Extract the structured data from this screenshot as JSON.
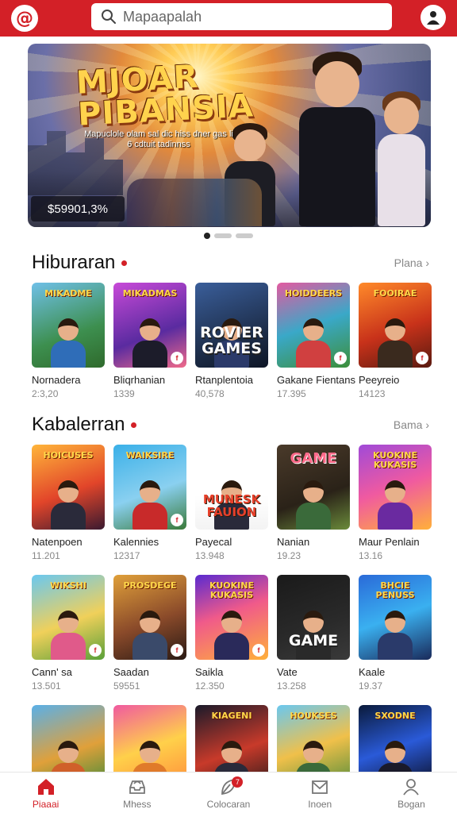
{
  "header": {
    "logo_glyph": "@",
    "search_placeholder": "Mapaapalah",
    "accent": "#d32027"
  },
  "banner": {
    "title_line1": "MJOAR",
    "title_line2": "PIBANSIA",
    "subtitle": "Mapuclole olam sal dic hiss dner gas li 6 cdtuit tadinnss",
    "price": "$59901,3%",
    "slide_count": 3,
    "active_slide": 1
  },
  "sections": [
    {
      "title": "Hiburaran",
      "see_all": "Plana",
      "items": [
        {
          "name": "Nornadera",
          "count": "2:3,20",
          "art": "MIKADME",
          "art_style": "top",
          "bg": "linear-gradient(160deg,#6fc0e8,#3d8f4f 60%,#2f6a2c)",
          "body": "#2f6db8",
          "badge": ""
        },
        {
          "name": "Bliqrhanian",
          "count": "1339",
          "art": "MIKADMAS",
          "art_style": "top",
          "bg": "linear-gradient(160deg,#c84ad8,#5a2ba0 60%,#f06a8a)",
          "body": "#1c1c2a",
          "badge": "f"
        },
        {
          "name": "Rtanplentoia",
          "count": "40,578",
          "art": "ROVIER GAMES",
          "art_style": "big",
          "bg": "linear-gradient(160deg,#3a5e9a,#1b2a44 70%,#0e1626)",
          "body": "#2b3a6a",
          "badge": ""
        },
        {
          "name": "Gakane Fientans",
          "count": "17.395",
          "art": "HOIDDEERS",
          "art_style": "top",
          "bg": "linear-gradient(160deg,#e35aa0,#3aa8c8 50%,#3d8f3a)",
          "body": "#d04040",
          "badge": "f"
        },
        {
          "name": "Peeyreio",
          "count": "14123",
          "art": "FOOIRAE",
          "art_style": "top",
          "bg": "linear-gradient(160deg,#ff8a2a,#c8321a 55%,#5a1a10)",
          "body": "#3a2a1e",
          "badge": "f"
        }
      ]
    },
    {
      "title": "Kabalerran",
      "see_all": "Bama",
      "items": [
        {
          "name": "Natenpoen",
          "count": "11.201",
          "art": "HOICUSES",
          "art_style": "top",
          "bg": "linear-gradient(160deg,#ffb53a,#e2452a 55%,#3a1a30)",
          "body": "#2a2a3a",
          "badge": ""
        },
        {
          "name": "Kalennies",
          "count": "12317",
          "art": "WAIKSIRE",
          "art_style": "top",
          "bg": "linear-gradient(160deg,#3ab0e8,#8ad0f0 55%,#3a7a3a)",
          "body": "#c82a2a",
          "badge": "f"
        },
        {
          "name": "Payecal",
          "count": "13.948",
          "art": "MUNESK FAUION",
          "art_style": "big",
          "bg": "linear-gradient(180deg,#ffffff,#ffffff 60%,#f3f3f3)",
          "body": "#2a2a3a",
          "badge": ""
        },
        {
          "name": "Nanian",
          "count": "19.23",
          "art": "GAME",
          "art_style": "topbig",
          "bg": "linear-gradient(160deg,#4a3a2a,#2a2218 60%,#6a8a3a)",
          "body": "#3a6a3a",
          "badge": ""
        },
        {
          "name": "Maur Penlain",
          "count": "13.16",
          "art": "KUOKINE KUKASIS",
          "art_style": "top",
          "bg": "linear-gradient(160deg,#a04ad8,#f05aa0 50%,#ffb03a)",
          "body": "#6a2aa0",
          "badge": ""
        },
        {
          "name": "Cann' sa",
          "count": "13.501",
          "art": "WIKSHI",
          "art_style": "top",
          "bg": "linear-gradient(160deg,#6ac8f0,#f0d05a 55%,#5aa03a)",
          "body": "#e05a8a",
          "badge": "f"
        },
        {
          "name": "Saadan",
          "count": "59551",
          "art": "PROSDEGE",
          "art_style": "top",
          "bg": "linear-gradient(160deg,#e0a03a,#8a4a2a 55%,#2a1a14)",
          "body": "#3a4a6a",
          "badge": "f"
        },
        {
          "name": "Saikla",
          "count": "12.350",
          "art": "KUOKINE KUKASIS",
          "art_style": "top",
          "bg": "linear-gradient(160deg,#5a2ad0,#f05a8a 45%,#ffb03a)",
          "body": "#2a2a5a",
          "badge": "f"
        },
        {
          "name": "Vate",
          "count": "13.258",
          "art": "GAME",
          "art_style": "big",
          "bg": "linear-gradient(160deg,#1a1a1a,#2a2a2a 60%,#3a3a3a)",
          "body": "#2a2a2a",
          "badge": ""
        },
        {
          "name": "Kaale",
          "count": "19.37",
          "art": "BHCIE PENUSS",
          "art_style": "top",
          "bg": "linear-gradient(160deg,#2a6ad8,#3ab0f0 50%,#1a2a5a)",
          "body": "#2a3a6a",
          "badge": ""
        },
        {
          "name": "",
          "count": "",
          "art": "",
          "art_style": "top",
          "bg": "linear-gradient(160deg,#5ab0e8,#e0a03a 55%,#3a8a3a)",
          "body": "#d0602a",
          "badge": ""
        },
        {
          "name": "",
          "count": "",
          "art": "",
          "art_style": "top",
          "bg": "linear-gradient(160deg,#f05aa0,#ffd04a 50%,#ff8a3a)",
          "body": "#e07a2a",
          "badge": ""
        },
        {
          "name": "",
          "count": "",
          "art": "KIAGENI",
          "art_style": "top",
          "bg": "linear-gradient(160deg,#1a1a2a,#c83a2a 55%,#2a1a1a)",
          "body": "#2a2a3a",
          "badge": ""
        },
        {
          "name": "",
          "count": "",
          "art": "HOUKSES",
          "art_style": "top",
          "bg": "linear-gradient(160deg,#6ac8f0,#f0c04a 50%,#4a8a3a)",
          "body": "#3a6a3a",
          "badge": ""
        },
        {
          "name": "",
          "count": "",
          "art": "SXODNE",
          "art_style": "top",
          "bg": "linear-gradient(160deg,#0a1a3a,#2a5ad8 50%,#0a0a1a)",
          "body": "#1a1a2a",
          "badge": ""
        }
      ]
    }
  ],
  "bottom_nav": [
    {
      "label": "Piaaai",
      "icon": "home-icon",
      "active": true
    },
    {
      "label": "Mhess",
      "icon": "inbox-icon",
      "active": false
    },
    {
      "label": "Colocaran",
      "icon": "leaf-icon",
      "active": false,
      "badge": "7"
    },
    {
      "label": "Inoen",
      "icon": "mail-icon",
      "active": false
    },
    {
      "label": "Bogan",
      "icon": "user-icon",
      "active": false
    }
  ]
}
